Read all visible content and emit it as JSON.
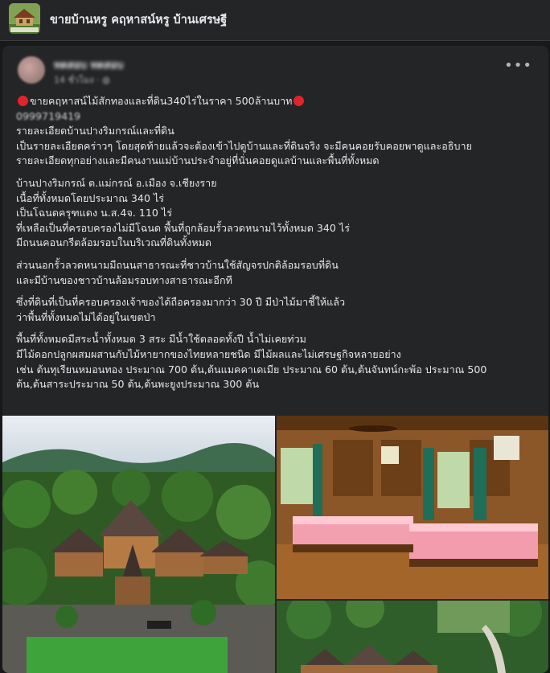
{
  "group": {
    "title": "ขายบ้านหรู คฤหาสน์หรู บ้านเศรษฐี",
    "thumbnail_icon": "group-house-thumbnail"
  },
  "post": {
    "author": "ทดสอบ ทดสอบ",
    "timestamp": "14 ชั่วโมง",
    "more_icon": "more-options-icon",
    "lines": {
      "headline": "ขายคฤหาสน์ไม้สักทองและที่ดิน340ไร่ในราคา 500ล้านบาท",
      "phone": "0999719419",
      "l1": "รายละเอียดบ้านปางริมกรณ์และที่ดิน",
      "l2": "เป็นรายละเอียดคร่าวๆ โดยสุดท้ายแล้วจะต้องเข้าไปดูบ้านและที่ดินจริง จะมีคนคอยรับคอยพาดูและอธิบาย",
      "l3": "รายละเอียดทุกอย่างและมีคนงานแม่บ้านประจำอยู่ที่นั่นคอยดูแลบ้านและพื้นที่ทั้งหมด",
      "l4": "บ้านปางริมกรณ์ ต.แม่กรณ์ อ.เมือง จ.เชียงราย",
      "l5": "เนื้อที่ทั้งหมดโดยประมาณ 340 ไร่",
      "l6": "เป็นโฉนดครุฑแดง น.ส.4จ. 110 ไร่",
      "l7": "ที่เหลือเป็นที่ครอบครองไม่มีโฉนด พื้นที่ถูกล้อมรั้วลวดหนามไว้ทั้งหมด 340 ไร่",
      "l8": "มีถนนคอนกรีตล้อมรอบในบริเวณที่ดินทั้งหมด",
      "l9": "ส่วนนอกรั้วลวดหนามมีถนนสาธารณะที่ชาวบ้านใช้สัญจรปกติล้อมรอบที่ดิน",
      "l10": "และมีบ้านของชาวบ้านล้อมรอบทางสาธารณะอีกที",
      "l11": "ซึ่งที่ดินที่เป็นที่ครอบครองเจ้าของได้ถือครองมากว่า 30 ปี มีป่าไม้มาชี้ให้แล้ว",
      "l12": "ว่าพื้นที่ทั้งหมดไม่ได้อยู่ในเขตป่า",
      "l13": "พื้นที่ทั้งหมดมีสระน้ำทั้งหมด 3 สระ มีน้ำใช้ตลอดทั้งปี น้ำไม่เคยท่วม",
      "l14": "มีไม้ดอกปลูกผสมผสานกับไม้หายากของไทยหลายชนิด มีไม้ผลและไม่เศรษฐกิจหลายอย่าง",
      "l15": "เช่น ต้นทุเรียนหมอนทอง ประมาณ 700 ต้น,ต้นแมคคาเดเมีย ประมาณ 60 ต้น,ต้นจันทน์กะพ้อ ประมาณ 500",
      "l16": "ต้น,ต้นสาระประมาณ 50 ต้น,ต้นพะยูงประมาณ 300 ต้น"
    },
    "photos": [
      {
        "name": "aerial-mansion-photo"
      },
      {
        "name": "teak-bedroom-photo"
      },
      {
        "name": "hillside-estate-photo"
      }
    ]
  },
  "colors": {
    "background": "#18191a",
    "card": "#242526",
    "text": "#e4e6eb",
    "secondary_text": "#b0b3b8",
    "red_circle": "#e0242b"
  }
}
